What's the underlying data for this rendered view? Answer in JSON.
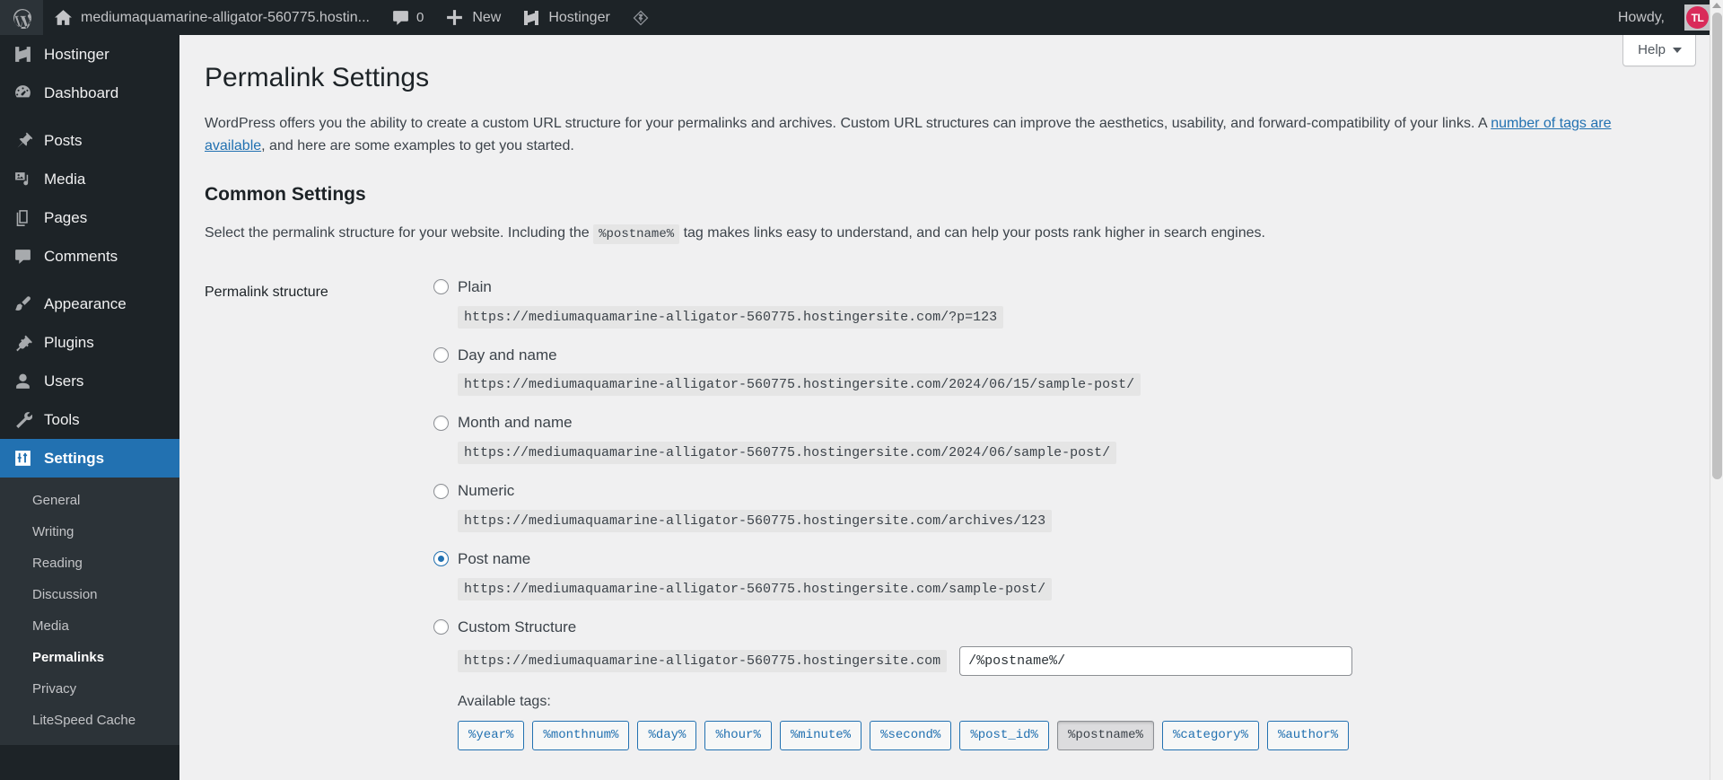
{
  "adminbar": {
    "wp_logo": "wordpress-logo",
    "site_name": "mediumaquamarine-alligator-560775.hostin...",
    "comments_count": "0",
    "new_label": "New",
    "hostinger_label": "Hostinger",
    "howdy": "Howdy,",
    "avatar_initials": "TL"
  },
  "sidebar": {
    "items": [
      {
        "label": "Hostinger",
        "icon": "hostinger-icon"
      },
      {
        "label": "Dashboard",
        "icon": "dashboard-icon"
      },
      {
        "label": "Posts",
        "icon": "pin-icon"
      },
      {
        "label": "Media",
        "icon": "media-icon"
      },
      {
        "label": "Pages",
        "icon": "pages-icon"
      },
      {
        "label": "Comments",
        "icon": "comments-icon"
      },
      {
        "label": "Appearance",
        "icon": "brush-icon"
      },
      {
        "label": "Plugins",
        "icon": "plugin-icon"
      },
      {
        "label": "Users",
        "icon": "user-icon"
      },
      {
        "label": "Tools",
        "icon": "wrench-icon"
      },
      {
        "label": "Settings",
        "icon": "settings-icon"
      }
    ],
    "submenu": [
      {
        "label": "General",
        "current": false
      },
      {
        "label": "Writing",
        "current": false
      },
      {
        "label": "Reading",
        "current": false
      },
      {
        "label": "Discussion",
        "current": false
      },
      {
        "label": "Media",
        "current": false
      },
      {
        "label": "Permalinks",
        "current": true
      },
      {
        "label": "Privacy",
        "current": false
      },
      {
        "label": "LiteSpeed Cache",
        "current": false
      }
    ]
  },
  "screen_meta": {
    "help_label": "Help"
  },
  "page": {
    "title": "Permalink Settings",
    "intro_part1": "WordPress offers you the ability to create a custom URL structure for your permalinks and archives. Custom URL structures can improve the aesthetics, usability, and forward-compatibility of your links. A ",
    "intro_link": "number of tags are available",
    "intro_part2": ", and here are some examples to get you started.",
    "common_settings_title": "Common Settings",
    "common_desc_part1": "Select the permalink structure for your website. Including the ",
    "common_desc_tag": "%postname%",
    "common_desc_part2": " tag makes links easy to understand, and can help your posts rank higher in search engines.",
    "permalink_structure_label": "Permalink structure",
    "options": [
      {
        "label": "Plain",
        "url": "https://mediumaquamarine-alligator-560775.hostingersite.com/?p=123",
        "selected": false
      },
      {
        "label": "Day and name",
        "url": "https://mediumaquamarine-alligator-560775.hostingersite.com/2024/06/15/sample-post/",
        "selected": false
      },
      {
        "label": "Month and name",
        "url": "https://mediumaquamarine-alligator-560775.hostingersite.com/2024/06/sample-post/",
        "selected": false
      },
      {
        "label": "Numeric",
        "url": "https://mediumaquamarine-alligator-560775.hostingersite.com/archives/123",
        "selected": false
      },
      {
        "label": "Post name",
        "url": "https://mediumaquamarine-alligator-560775.hostingersite.com/sample-post/",
        "selected": true
      }
    ],
    "custom": {
      "label": "Custom Structure",
      "selected": false,
      "prefix": "https://mediumaquamarine-alligator-560775.hostingersite.com",
      "value": "/%postname%/",
      "placeholder": ""
    },
    "available_tags_label": "Available tags:",
    "tags": [
      {
        "label": "%year%",
        "active": false
      },
      {
        "label": "%monthnum%",
        "active": false
      },
      {
        "label": "%day%",
        "active": false
      },
      {
        "label": "%hour%",
        "active": false
      },
      {
        "label": "%minute%",
        "active": false
      },
      {
        "label": "%second%",
        "active": false
      },
      {
        "label": "%post_id%",
        "active": false
      },
      {
        "label": "%postname%",
        "active": true
      },
      {
        "label": "%category%",
        "active": false
      },
      {
        "label": "%author%",
        "active": false
      }
    ]
  },
  "colors": {
    "admin_bar": "#1d2327",
    "accent": "#2271b1",
    "body_bg": "#f0f0f1",
    "avatar": "#d92b5a"
  }
}
